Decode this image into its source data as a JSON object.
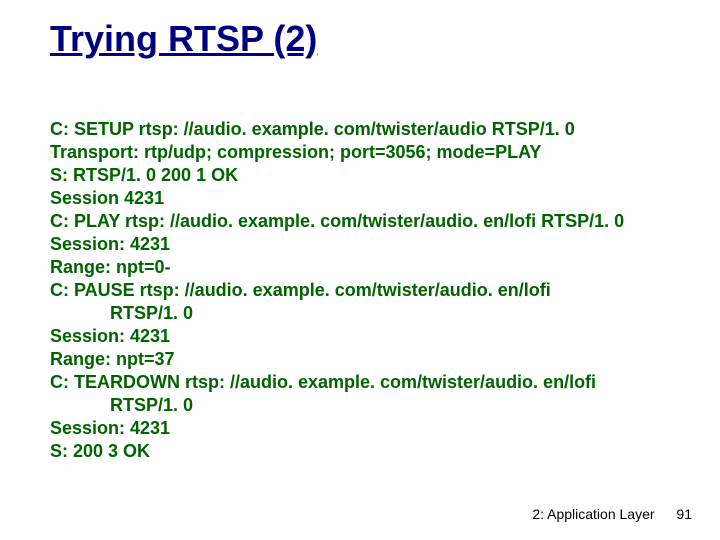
{
  "title": "Trying RTSP (2)",
  "lines": [
    "C: SETUP rtsp: //audio. example. com/twister/audio RTSP/1. 0",
    "Transport: rtp/udp; compression; port=3056; mode=PLAY",
    "S: RTSP/1. 0 200 1 OK",
    "Session 4231",
    "C: PLAY rtsp: //audio. example. com/twister/audio. en/lofi RTSP/1. 0",
    "Session: 4231",
    "Range: npt=0-",
    "C: PAUSE rtsp: //audio. example. com/twister/audio. en/lofi",
    "RTSP/1. 0",
    "Session: 4231",
    "Range: npt=37",
    "C: TEARDOWN rtsp: //audio. example. com/twister/audio. en/lofi",
    "RTSP/1. 0",
    "Session: 4231",
    "S: 200 3 OK"
  ],
  "indent_lines": [
    8,
    12
  ],
  "footer": {
    "chapter": "2: Application Layer",
    "page": "91"
  }
}
